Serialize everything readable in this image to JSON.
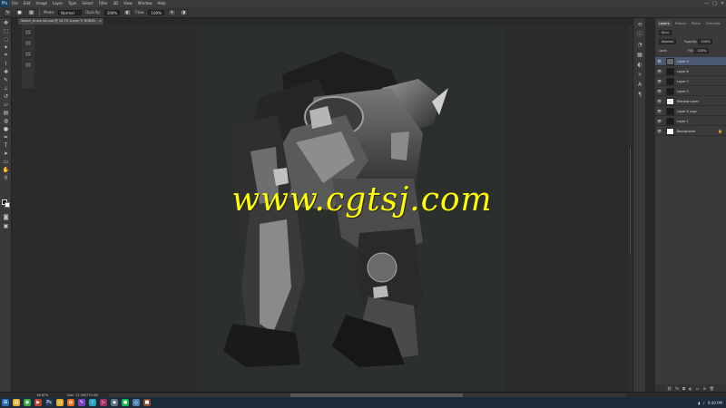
{
  "app": {
    "logo": "Ps"
  },
  "menu": [
    "File",
    "Edit",
    "Image",
    "Layer",
    "Type",
    "Select",
    "Filter",
    "3D",
    "View",
    "Window",
    "Help"
  ],
  "window_controls": [
    "—",
    "□",
    "✕"
  ],
  "options_bar": {
    "mode_label": "Mode:",
    "mode_value": "Normal",
    "opacity_label": "Opacity:",
    "opacity_value": "100%",
    "flow_label": "Flow:",
    "flow_value": "100%"
  },
  "document_tab": {
    "title": "Sketch_Brush full.psd @ 16.7% (Layer 9, RGB/8)",
    "close": "×"
  },
  "watermark": "www.cgtsj.com",
  "layers_panel": {
    "tabs": [
      "Layers",
      "History",
      "Paths",
      "Channels"
    ],
    "kind_label": "Kind",
    "blend_mode": "Normal",
    "opacity_label": "Opacity:",
    "opacity_value": "100%",
    "lock_label": "Lock:",
    "fill_label": "Fill:",
    "fill_value": "100%",
    "layers": [
      {
        "name": "Layer 9",
        "selected": true,
        "thumb": "#6a6a6a"
      },
      {
        "name": "Layer 8",
        "selected": false,
        "thumb": "#1a1a1a"
      },
      {
        "name": "Layer 3",
        "selected": false,
        "thumb": "#1a1a1a"
      },
      {
        "name": "Layer 2",
        "selected": false,
        "thumb": "#1a1a1a"
      },
      {
        "name": "Shadow Layer",
        "selected": false,
        "thumb": "#eeeeee"
      },
      {
        "name": "Layer 6 copy",
        "selected": false,
        "thumb": "#1a1a1a"
      },
      {
        "name": "Layer 1",
        "selected": false,
        "thumb": "#1a1a1a"
      },
      {
        "name": "Background",
        "selected": false,
        "thumb": "#ffffff",
        "locked": true
      }
    ],
    "footer_icons": [
      "link-icon",
      "fx-icon",
      "mask-icon",
      "adjust-icon",
      "folder-icon",
      "new-icon",
      "trash-icon"
    ]
  },
  "status": {
    "zoom": "16.67%",
    "doc": "Doc: 12.2M/770.0M"
  },
  "taskbar": {
    "icons": [
      "windows-icon",
      "explorer-icon",
      "chrome-icon",
      "media-icon",
      "photoshop-icon",
      "folder-icon",
      "firefox-icon",
      "paint-icon",
      "music-icon",
      "video-icon",
      "app-icon",
      "spotify-icon",
      "app2-icon",
      "app3-icon"
    ],
    "clock": "9:40 PM"
  }
}
